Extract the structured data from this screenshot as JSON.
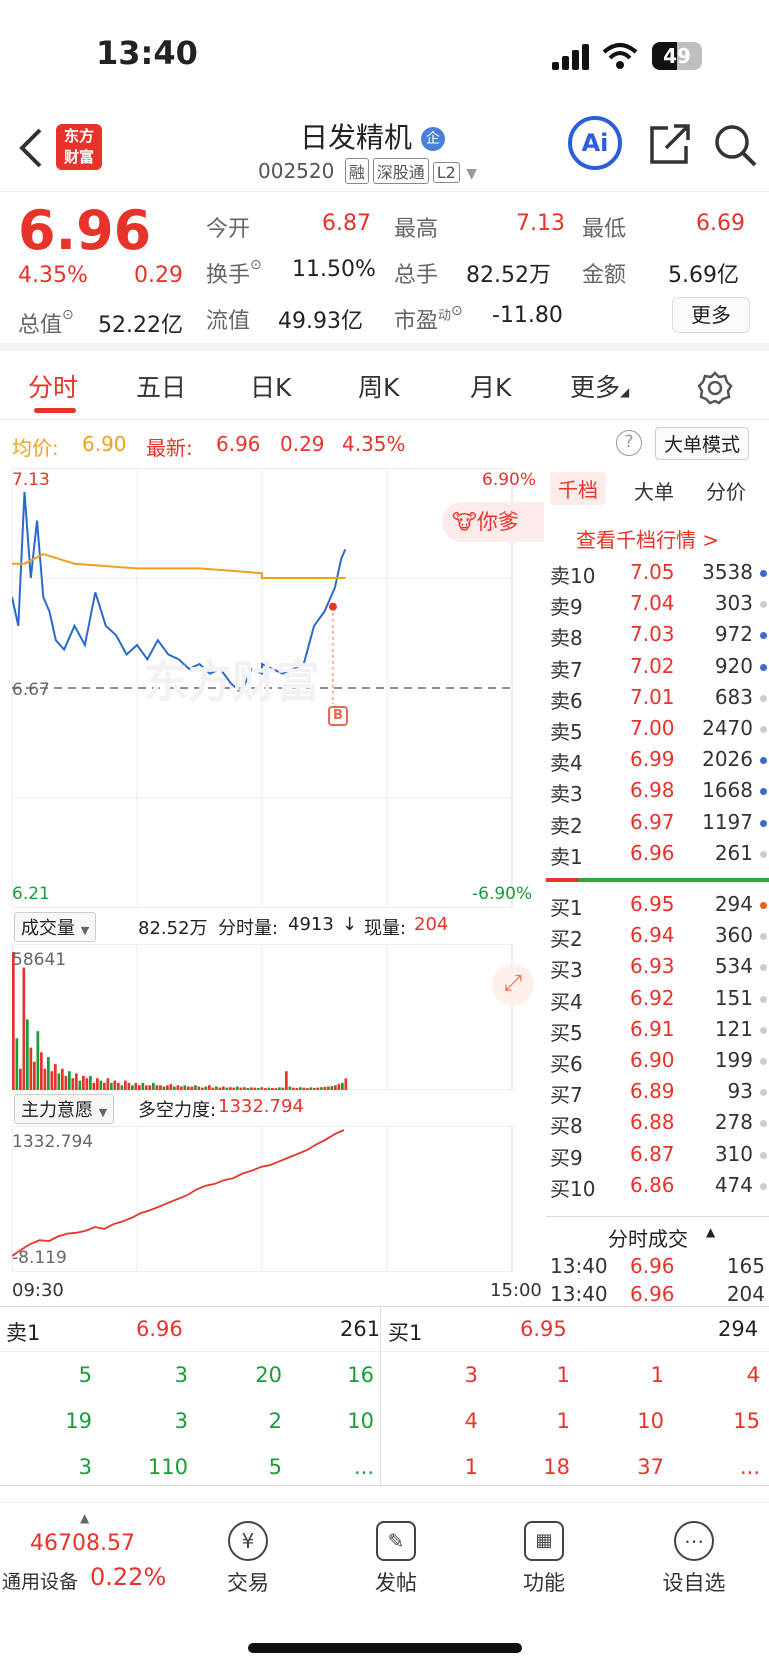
{
  "status": {
    "time": "13:40",
    "battery": "49",
    "battery_level": 0.49
  },
  "header": {
    "logo_text": "东方财富",
    "stock_name": "日发精机",
    "stock_code": "002520",
    "tags": [
      "融",
      "深股通",
      "L2"
    ],
    "ai_label": "Ai"
  },
  "quote": {
    "price": "6.96",
    "change_pct": "4.35%",
    "change": "0.29",
    "open_label": "今开",
    "open": "6.87",
    "high_label": "最高",
    "high": "7.13",
    "low_label": "最低",
    "low": "6.69",
    "turnover_label": "换手",
    "turnover": "11.50%",
    "volume_label": "总手",
    "volume": "82.52万",
    "amount_label": "金额",
    "amount": "5.69亿",
    "mktcap_label": "总值",
    "mktcap": "52.22亿",
    "float_label": "流值",
    "float": "49.93亿",
    "pe_label": "市盈",
    "pe_sup": "动",
    "pe": "-11.80",
    "more": "更多"
  },
  "tabs": [
    "分时",
    "五日",
    "日K",
    "周K",
    "月K",
    "更多"
  ],
  "info": {
    "avg_label": "均价:",
    "avg": "6.90",
    "latest_label": "最新:",
    "latest": "6.96",
    "change": "0.29",
    "change_pct": "4.35%",
    "mode_button": "大单模式"
  },
  "chart_axis": {
    "top_left": "7.13",
    "top_right": "6.90%",
    "mid_left": "6.67",
    "bottom_left": "6.21",
    "bottom_right": "-6.90%",
    "time_start": "09:30",
    "time_end": "15:00",
    "watermark": "东方财富",
    "banner": "你爹",
    "trade_marker": "B"
  },
  "chart_data": {
    "type": "line",
    "title": "",
    "ylim": [
      6.21,
      7.13
    ],
    "series": [
      {
        "name": "最新",
        "x": [
          "09:30",
          "09:33",
          "09:36",
          "09:39",
          "09:42",
          "09:45",
          "09:48",
          "09:51",
          "09:55",
          "10:00",
          "10:05",
          "10:10",
          "10:15",
          "10:20",
          "10:25",
          "10:30",
          "10:35",
          "10:40",
          "10:45",
          "10:50",
          "10:55",
          "11:00",
          "11:05",
          "11:10",
          "11:15",
          "11:20",
          "11:25",
          "11:30",
          "13:00",
          "13:05",
          "13:10",
          "13:15",
          "13:20",
          "13:25",
          "13:30",
          "13:35",
          "13:38",
          "13:40"
        ],
        "values": [
          6.86,
          6.8,
          7.08,
          6.9,
          7.02,
          6.86,
          6.83,
          6.77,
          6.75,
          6.8,
          6.76,
          6.87,
          6.8,
          6.78,
          6.74,
          6.76,
          6.73,
          6.77,
          6.74,
          6.73,
          6.71,
          6.72,
          6.7,
          6.71,
          6.68,
          6.66,
          6.71,
          6.7,
          6.72,
          6.71,
          6.7,
          6.71,
          6.72,
          6.8,
          6.83,
          6.88,
          6.94,
          6.96
        ]
      },
      {
        "name": "均价",
        "x": [
          "09:30",
          "09:36",
          "09:45",
          "10:00",
          "10:30",
          "11:00",
          "11:30",
          "13:00",
          "13:30",
          "13:40"
        ],
        "values": [
          6.93,
          6.93,
          6.95,
          6.93,
          6.92,
          6.92,
          6.91,
          6.9,
          6.9,
          6.9
        ]
      }
    ]
  },
  "volume_panel": {
    "label": "成交量",
    "total": "82.52万",
    "minute_label": "分时量:",
    "minute_vol": "4913",
    "arrow": "↓",
    "now_label": "现量:",
    "now_vol": "204",
    "max": "58641",
    "bars": [
      58641,
      22000,
      9000,
      52000,
      30000,
      18000,
      12000,
      25000,
      16000,
      9000,
      14000,
      8000,
      11000,
      7000,
      9000,
      6000,
      8000,
      5000,
      7000,
      4000,
      6000,
      5000,
      6000,
      3000,
      5000,
      4000,
      3000,
      5000,
      3000,
      4000,
      3000,
      2000,
      4000,
      3000,
      2000,
      3000,
      2000,
      3000,
      2000,
      2000,
      3000,
      2000,
      2000,
      1500,
      2000,
      2500,
      1500,
      2000,
      1500,
      2000,
      1500,
      1500,
      2000,
      1500,
      1000,
      1500,
      2000,
      1000,
      1500,
      1000,
      1500,
      1000,
      1200,
      1000,
      1500,
      1000,
      1200,
      900,
      1100,
      1000,
      900,
      1200,
      800,
      1000,
      900,
      800,
      1100,
      1000,
      8000,
      1500,
      1000,
      900,
      1200,
      1000,
      800,
      1100,
      900,
      1000,
      1200,
      1300,
      1500,
      1700,
      2000,
      2500,
      3000,
      4913
    ]
  },
  "main_force": {
    "label": "主力意愿",
    "strength_label": "多空力度:",
    "strength": "1332.794",
    "max": "1332.794",
    "min": "-8.119",
    "values": [
      -8.1,
      60,
      120,
      160,
      150,
      200,
      230,
      240,
      260,
      300,
      280,
      330,
      360,
      400,
      450,
      480,
      520,
      560,
      600,
      640,
      700,
      740,
      760,
      800,
      820,
      870,
      900,
      940,
      960,
      1000,
      1040,
      1080,
      1120,
      1180,
      1230,
      1290,
      1332.8
    ]
  },
  "book": {
    "tabs": [
      "千档",
      "大单",
      "分价"
    ],
    "link": "查看千档行情 >",
    "asks": [
      {
        "label": "卖10",
        "price": "7.05",
        "vol": "3538",
        "dot": "#3a6ccf"
      },
      {
        "label": "卖9",
        "price": "7.04",
        "vol": "303",
        "dot": "#cccccc"
      },
      {
        "label": "卖8",
        "price": "7.03",
        "vol": "972",
        "dot": "#3a6ccf"
      },
      {
        "label": "卖7",
        "price": "7.02",
        "vol": "920",
        "dot": "#3a6ccf"
      },
      {
        "label": "卖6",
        "price": "7.01",
        "vol": "683",
        "dot": "#cccccc"
      },
      {
        "label": "卖5",
        "price": "7.00",
        "vol": "2470",
        "dot": "#cccccc"
      },
      {
        "label": "卖4",
        "price": "6.99",
        "vol": "2026",
        "dot": "#3a6ccf"
      },
      {
        "label": "卖3",
        "price": "6.98",
        "vol": "1668",
        "dot": "#3a6ccf"
      },
      {
        "label": "卖2",
        "price": "6.97",
        "vol": "1197",
        "dot": "#3a6ccf"
      },
      {
        "label": "卖1",
        "price": "6.96",
        "vol": "261",
        "dot": "#cccccc"
      }
    ],
    "bids": [
      {
        "label": "买1",
        "price": "6.95",
        "vol": "294",
        "dot": "#e8601c"
      },
      {
        "label": "买2",
        "price": "6.94",
        "vol": "360",
        "dot": "#cccccc"
      },
      {
        "label": "买3",
        "price": "6.93",
        "vol": "534",
        "dot": "#cccccc"
      },
      {
        "label": "买4",
        "price": "6.92",
        "vol": "151",
        "dot": "#cccccc"
      },
      {
        "label": "买5",
        "price": "6.91",
        "vol": "121",
        "dot": "#cccccc"
      },
      {
        "label": "买6",
        "price": "6.90",
        "vol": "199",
        "dot": "#cccccc"
      },
      {
        "label": "买7",
        "price": "6.89",
        "vol": "93",
        "dot": "#cccccc"
      },
      {
        "label": "买8",
        "price": "6.88",
        "vol": "278",
        "dot": "#cccccc"
      },
      {
        "label": "买9",
        "price": "6.87",
        "vol": "310",
        "dot": "#cccccc"
      },
      {
        "label": "买10",
        "price": "6.86",
        "vol": "474",
        "dot": "#cccccc"
      }
    ],
    "ticks_title": "分时成交",
    "ticks": [
      {
        "time": "13:40",
        "price": "6.96",
        "vol": "165"
      },
      {
        "time": "13:40",
        "price": "6.96",
        "vol": "204"
      }
    ]
  },
  "queue": {
    "sell_label": "卖1",
    "sell_price": "6.96",
    "sell_total": "261",
    "buy_label": "买1",
    "buy_price": "6.95",
    "buy_total": "294",
    "sell_rows": [
      [
        "5",
        "3",
        "20",
        "16"
      ],
      [
        "19",
        "3",
        "2",
        "10"
      ],
      [
        "3",
        "110",
        "5",
        "..."
      ]
    ],
    "buy_rows": [
      [
        "3",
        "1",
        "1",
        "4"
      ],
      [
        "4",
        "1",
        "10",
        "15"
      ],
      [
        "1",
        "18",
        "37",
        "..."
      ]
    ]
  },
  "nav": {
    "index_value": "46708.57",
    "index_name": "通用设备",
    "index_pct": "0.22%",
    "items": [
      "交易",
      "发帖",
      "功能",
      "设自选"
    ]
  },
  "colors": {
    "up": "#e8332a",
    "down": "#1a9c3a",
    "price_line": "#2a6ac8",
    "avg_line": "#f0a020"
  }
}
